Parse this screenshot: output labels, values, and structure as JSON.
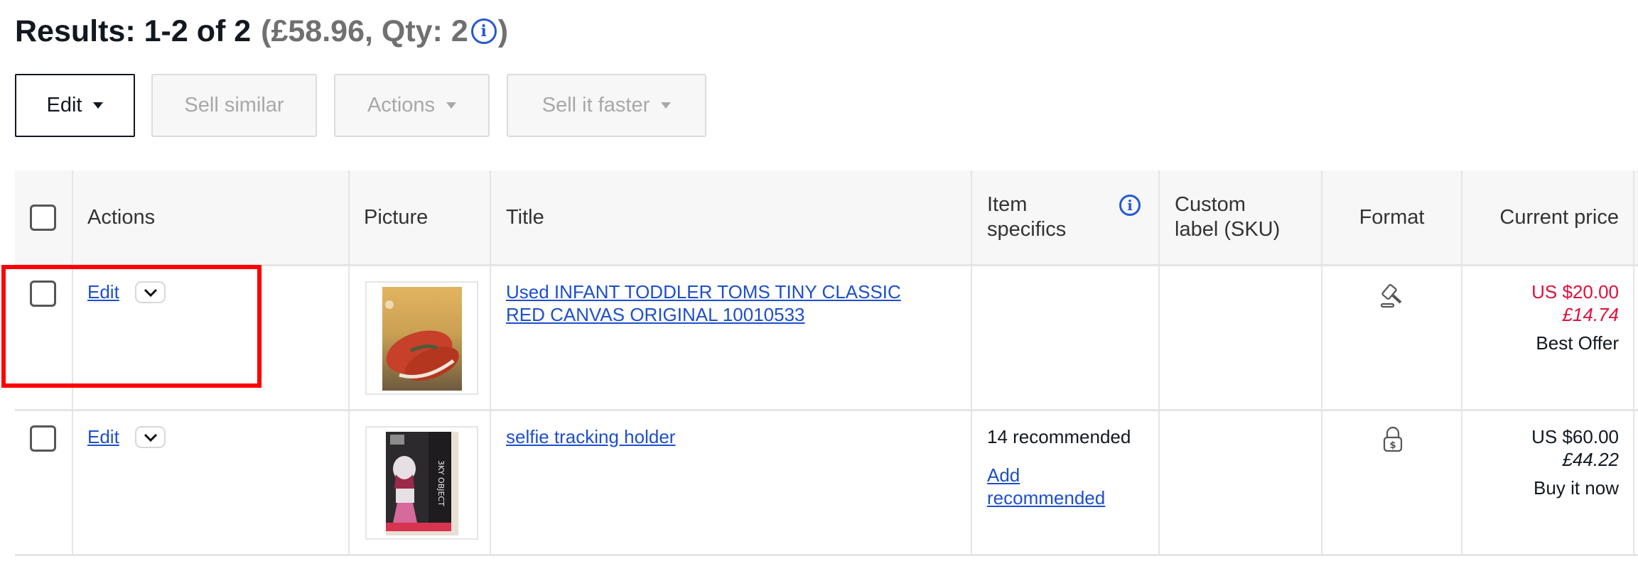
{
  "header": {
    "results_label": "Results: 1-2 of 2",
    "summary_label": "(£58.96, Qty: 2",
    "summary_close": ")",
    "info_icon": "info-icon"
  },
  "toolbar": {
    "edit_label": "Edit",
    "sell_similar_label": "Sell similar",
    "actions_label": "Actions",
    "sell_faster_label": "Sell it faster"
  },
  "table": {
    "columns": {
      "actions": "Actions",
      "picture": "Picture",
      "title": "Title",
      "item_specifics_line1": "Item",
      "item_specifics_line2": "specifics",
      "custom_label_line1": "Custom",
      "custom_label_line2": "label (SKU)",
      "format": "Format",
      "current_price": "Current price"
    },
    "rows": [
      {
        "edit_label": "Edit",
        "title_line1": "Used INFANT TODDLER TOMS TINY CLASSIC",
        "title_line2": "RED CANVAS ORIGINAL 10010533",
        "item_specifics": "",
        "custom_label": "",
        "format_icon": "auction-gavel-icon",
        "price_usd": "US $20.00",
        "price_gbp": "£14.74",
        "price_type": "Best Offer",
        "price_color": "#e0103a",
        "thumbnail": "red-shoes-photo"
      },
      {
        "edit_label": "Edit",
        "title_line1": "selfie tracking holder",
        "title_line2": "",
        "item_specifics": "14 recommended",
        "item_specifics_link_line1": "Add",
        "item_specifics_link_line2": "recommended",
        "custom_label": "",
        "format_icon": "fixed-price-lock-icon",
        "price_usd": "US $60.00",
        "price_gbp": "£44.22",
        "price_type": "Buy it now",
        "price_color": "#111820",
        "thumbnail": "selfie-holder-box-photo"
      }
    ]
  },
  "annotation": {
    "highlight_color": "#ff0000",
    "highlight_target": "row-1-actions"
  }
}
